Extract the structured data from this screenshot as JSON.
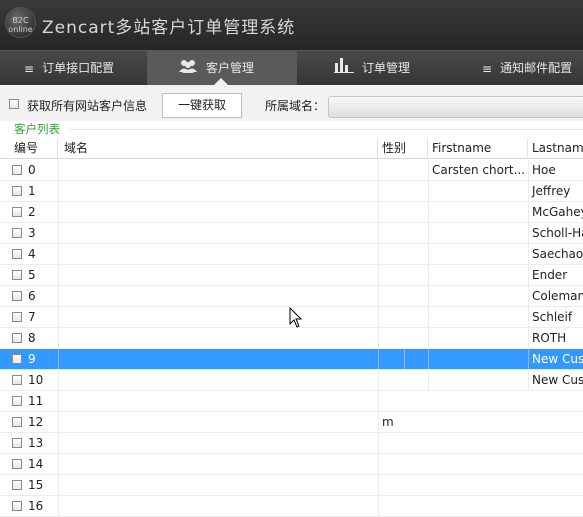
{
  "app": {
    "title": "Zencart多站客户订单管理系统",
    "logo_text": "B2C online"
  },
  "tabs": [
    {
      "label": "订单接口配置",
      "icon": "menu-lines-icon",
      "active": false
    },
    {
      "label": "客户管理",
      "icon": "users-icon",
      "active": true
    },
    {
      "label": "订单管理",
      "icon": "bar-chart-icon",
      "active": false
    },
    {
      "label": "通知邮件配置",
      "icon": "menu-lines-icon",
      "active": false
    }
  ],
  "toolbar": {
    "fetch_all_label": "获取所有网站客户信息",
    "one_click_label": "一键获取",
    "domain_label": "所属域名：",
    "domain_value": ""
  },
  "section": {
    "title": "客户列表"
  },
  "table": {
    "columns": [
      "编号",
      "域名",
      "性别",
      "Firstname",
      "Lastname"
    ],
    "rows": [
      {
        "id": "0",
        "domain": "",
        "gender": "",
        "first": "Carsten chort...",
        "last": "Hoe"
      },
      {
        "id": "1",
        "domain": "",
        "gender": "",
        "first": "",
        "last": "Jeffrey"
      },
      {
        "id": "2",
        "domain": "",
        "gender": "",
        "first": "",
        "last": "McGahey"
      },
      {
        "id": "3",
        "domain": "",
        "gender": "",
        "first": "",
        "last": "Scholl-Ha"
      },
      {
        "id": "4",
        "domain": "",
        "gender": "",
        "first": "",
        "last": "Saechao"
      },
      {
        "id": "5",
        "domain": "",
        "gender": "",
        "first": "",
        "last": "Ender"
      },
      {
        "id": "6",
        "domain": "",
        "gender": "",
        "first": "",
        "last": "Coleman"
      },
      {
        "id": "7",
        "domain": "",
        "gender": "",
        "first": "",
        "last": "Schleif"
      },
      {
        "id": "8",
        "domain": "",
        "gender": "",
        "first": "",
        "last": "ROTH"
      },
      {
        "id": "9",
        "domain": "",
        "gender": "",
        "first": "",
        "last": "New Cus"
      },
      {
        "id": "10",
        "domain": "",
        "gender": "",
        "first": "",
        "last": "New Cus"
      },
      {
        "id": "11",
        "domain": "",
        "gender": "",
        "first": "",
        "last": ""
      },
      {
        "id": "12",
        "domain": "",
        "gender": "m",
        "first": "",
        "last": ""
      },
      {
        "id": "13",
        "domain": "",
        "gender": "",
        "first": "",
        "last": ""
      },
      {
        "id": "14",
        "domain": "",
        "gender": "",
        "first": "",
        "last": ""
      },
      {
        "id": "15",
        "domain": "",
        "gender": "",
        "first": "",
        "last": ""
      },
      {
        "id": "16",
        "domain": "",
        "gender": "",
        "first": "",
        "last": ""
      }
    ],
    "selected_id": "9"
  },
  "colors": {
    "selection": "#3399ff",
    "section_title": "#3c9a3c",
    "titlebar": "#2e2e2e"
  }
}
